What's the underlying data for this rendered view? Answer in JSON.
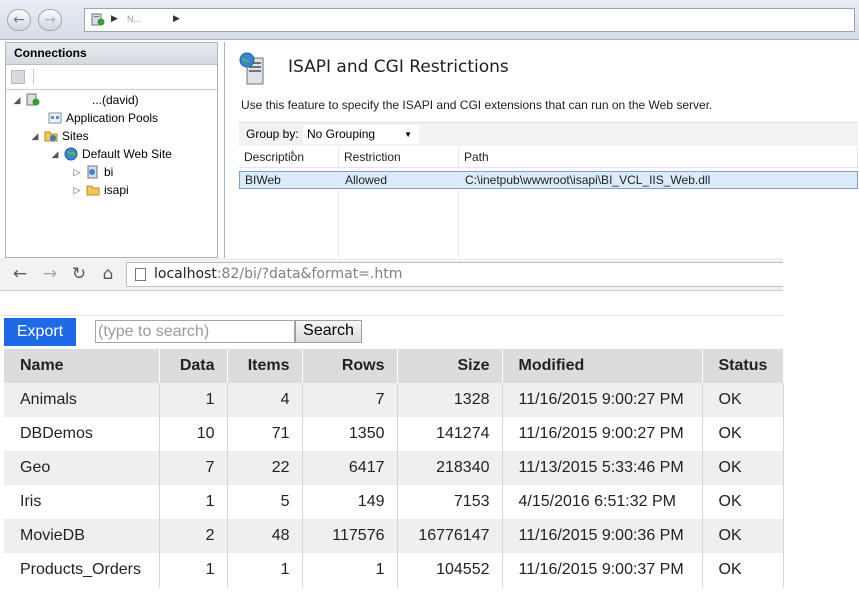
{
  "iis": {
    "breadcrumb_server": "N...",
    "connections": {
      "header": "Connections",
      "tree": [
        {
          "label": "...(david)",
          "level": 0,
          "expanded": true
        },
        {
          "label": "Application Pools",
          "level": 1
        },
        {
          "label": "Sites",
          "level": 1,
          "expanded": true
        },
        {
          "label": "Default Web Site",
          "level": 2,
          "expanded": true
        },
        {
          "label": "bi",
          "level": 3,
          "collapsed": true
        },
        {
          "label": "isapi",
          "level": 3,
          "collapsed": true
        }
      ]
    },
    "feature": {
      "title": "ISAPI and CGI Restrictions",
      "description": "Use this feature to specify the ISAPI and CGI extensions that can run on the Web server.",
      "group_by_label": "Group by:",
      "group_by_value": "No Grouping",
      "columns": [
        "Description",
        "Restriction",
        "Path"
      ],
      "rows": [
        {
          "description": "BIWeb",
          "restriction": "Allowed",
          "path": "C:\\inetpub\\wwwroot\\isapi\\BI_VCL_IIS_Web.dll"
        }
      ]
    }
  },
  "browser": {
    "url_host": "localhost",
    "url_rest": ":82/bi/?data&format=.htm",
    "export_label": "Export",
    "search_placeholder": "(type to search)",
    "search_label": "Search",
    "accent_color": "#1e6ae6",
    "table": {
      "columns": [
        "Name",
        "Data",
        "Items",
        "Rows",
        "Size",
        "Modified",
        "Status"
      ],
      "rows": [
        [
          "Animals",
          "1",
          "4",
          "7",
          "1328",
          "11/16/2015 9:00:27 PM",
          "OK"
        ],
        [
          "DBDemos",
          "10",
          "71",
          "1350",
          "141274",
          "11/16/2015 9:00:27 PM",
          "OK"
        ],
        [
          "Geo",
          "7",
          "22",
          "6417",
          "218340",
          "11/13/2015 5:33:46 PM",
          "OK"
        ],
        [
          "Iris",
          "1",
          "5",
          "149",
          "7153",
          "4/15/2016 6:51:32 PM",
          "OK"
        ],
        [
          "MovieDB",
          "2",
          "48",
          "117576",
          "16776147",
          "11/16/2015 9:00:36 PM",
          "OK"
        ],
        [
          "Products_Orders",
          "1",
          "1",
          "1",
          "104552",
          "11/16/2015 9:00:37 PM",
          "OK"
        ]
      ]
    }
  }
}
